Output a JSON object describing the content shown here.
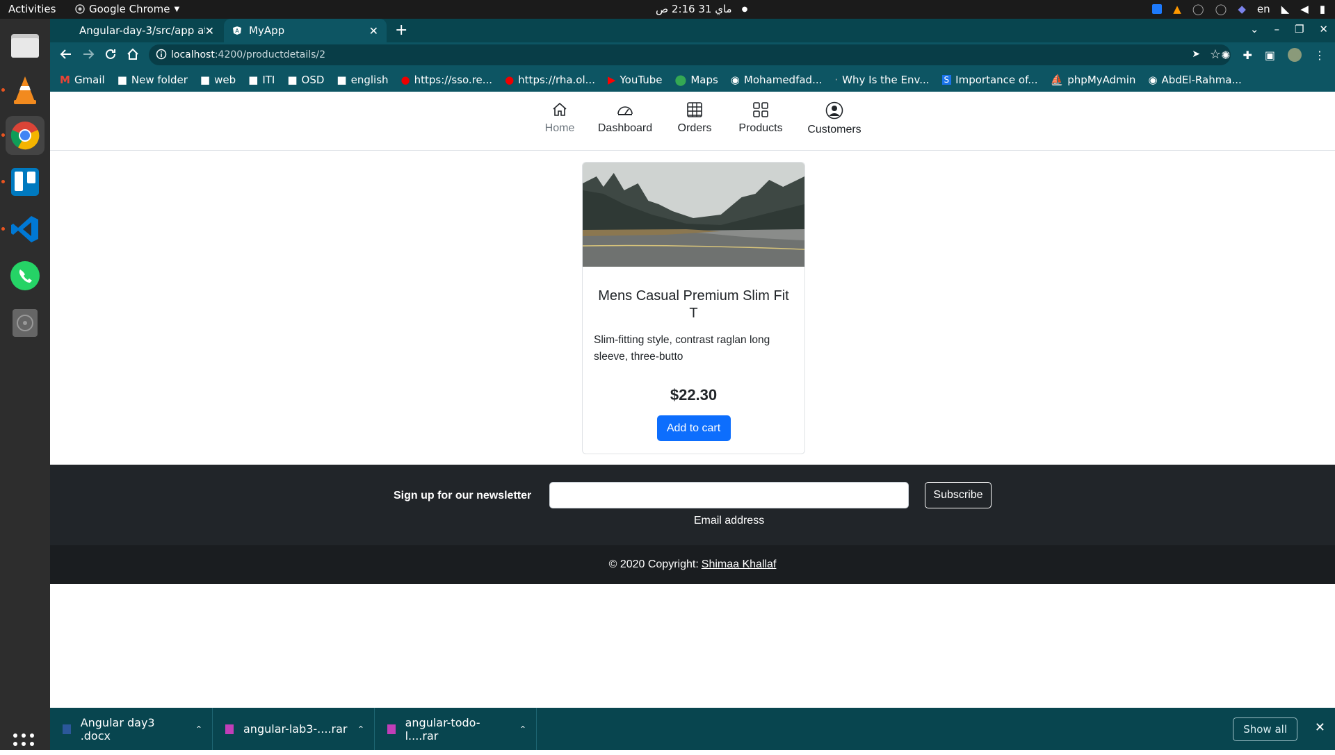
{
  "os": {
    "activities": "Activities",
    "app_name": "Google Chrome",
    "clock": "ماي 31  2:16 ص",
    "lang": "en"
  },
  "browser": {
    "tabs": [
      {
        "label": "Angular-day-3/src/app at"
      },
      {
        "label": "MyApp"
      }
    ],
    "url_host": "localhost",
    "url_path": ":4200/productdetails/2",
    "bookmarks": [
      "Gmail",
      "New folder",
      "web",
      "ITI",
      "OSD",
      "english",
      "https://sso.re...",
      "https://rha.ol...",
      "YouTube",
      "Maps",
      "Mohamedfad...",
      "Why Is the Env...",
      "Importance of...",
      "phpMyAdmin",
      "AbdEl-Rahma..."
    ]
  },
  "nav": {
    "items": [
      {
        "label": "Home",
        "icon": "home-icon"
      },
      {
        "label": "Dashboard",
        "icon": "speedometer-icon"
      },
      {
        "label": "Orders",
        "icon": "table-icon"
      },
      {
        "label": "Products",
        "icon": "grid-icon"
      },
      {
        "label": "Customers",
        "icon": "person-circle-icon"
      }
    ]
  },
  "product": {
    "title": "Mens Casual Premium Slim Fit T",
    "description": "Slim-fitting style, contrast raglan long sleeve, three-butto",
    "price": "$22.30",
    "button": "Add to cart"
  },
  "newsletter": {
    "label": "Sign up for our newsletter",
    "input_help": "Email address",
    "button": "Subscribe"
  },
  "footer": {
    "copyright": "© 2020 Copyright:",
    "author": "Shimaa Khallaf"
  },
  "downloads": {
    "items": [
      "Angular day3 .docx",
      "angular-lab3-....rar",
      "angular-todo-l....rar"
    ],
    "show_all": "Show all"
  },
  "colors": {
    "chrome_bg": "#08454f",
    "primary_button": "#0d6efd",
    "footer_bg": "#212529"
  }
}
